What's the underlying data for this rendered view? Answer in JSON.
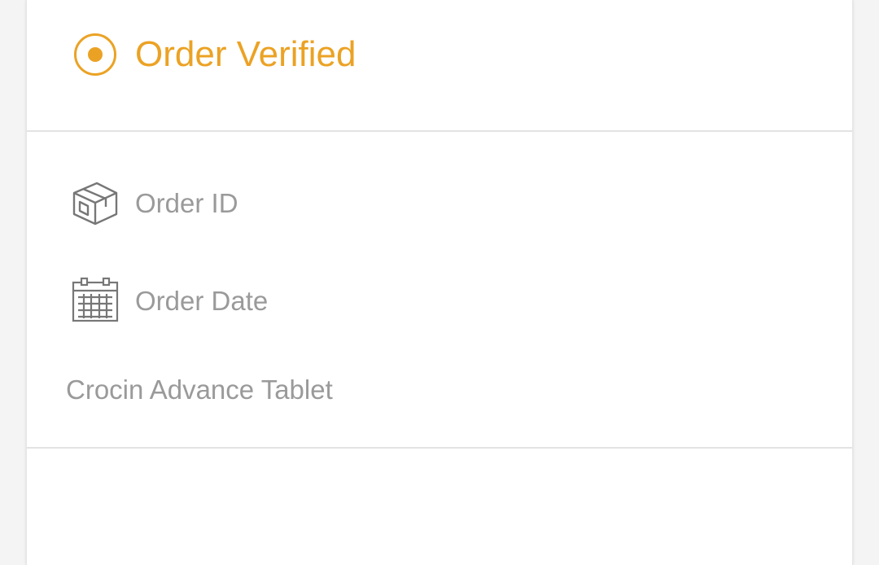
{
  "order_status": {
    "label": "Order Verified",
    "icon": "radio-selected-icon",
    "accent_color": "#eba224"
  },
  "details": {
    "order_id_label": "Order ID",
    "order_id_icon": "package-box-icon",
    "order_date_label": "Order Date",
    "order_date_icon": "calendar-icon",
    "product_name": "Crocin Advance Tablet"
  },
  "colors": {
    "label_gray": "#9a9a9a",
    "divider": "#e3e3e3",
    "background": "#f4f4f4",
    "card": "#ffffff"
  }
}
